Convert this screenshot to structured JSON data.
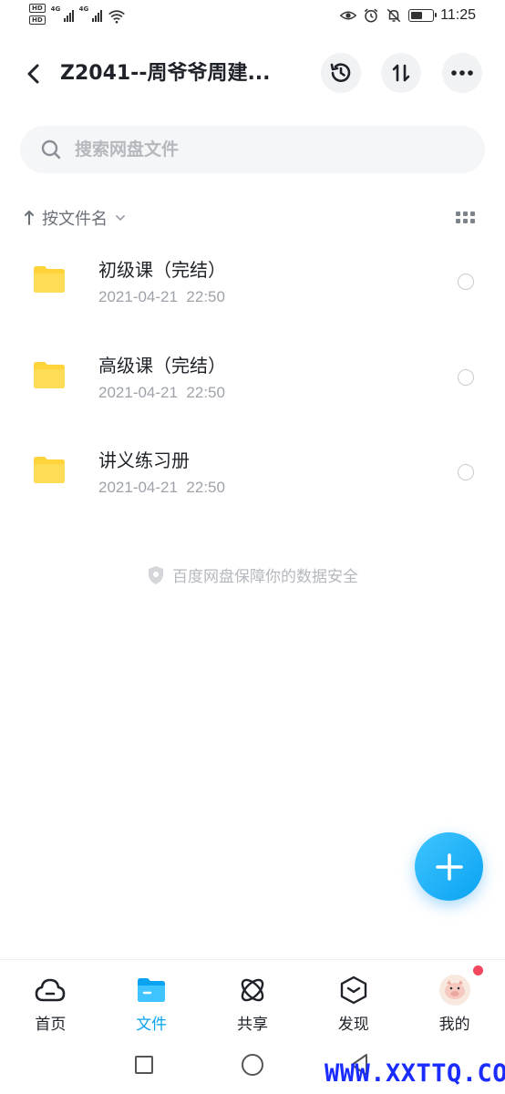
{
  "status_bar": {
    "hd1": "HD",
    "hd2": "HD",
    "net1": "4G",
    "net2": "4G",
    "time": "11:25",
    "battery_level": 0.55
  },
  "header": {
    "title": "Z2041--周爷爷周建..."
  },
  "search": {
    "placeholder": "搜索网盘文件"
  },
  "sort": {
    "label": "按文件名"
  },
  "files": [
    {
      "name": "初级课（完结）",
      "date": "2021-04-21  22:50",
      "icon": "folder-icon"
    },
    {
      "name": "高级课（完结）",
      "date": "2021-04-21  22:50",
      "icon": "folder-icon"
    },
    {
      "name": "讲义练习册",
      "date": "2021-04-21  22:50",
      "icon": "folder-icon"
    }
  ],
  "secure_note": "百度网盘保障你的数据安全",
  "bottom_nav": [
    {
      "label": "首页",
      "icon": "cloud-icon",
      "active": false
    },
    {
      "label": "文件",
      "icon": "folder-icon",
      "active": true
    },
    {
      "label": "共享",
      "icon": "share-atom-icon",
      "active": false
    },
    {
      "label": "发现",
      "icon": "discover-icon",
      "active": false
    },
    {
      "label": "我的",
      "icon": "avatar",
      "active": false
    }
  ],
  "watermark": "WWW.XXTTQ.COM",
  "colors": {
    "accent": "#0aa3f2",
    "folder": "#ffd43b",
    "badge": "#f2475d"
  }
}
